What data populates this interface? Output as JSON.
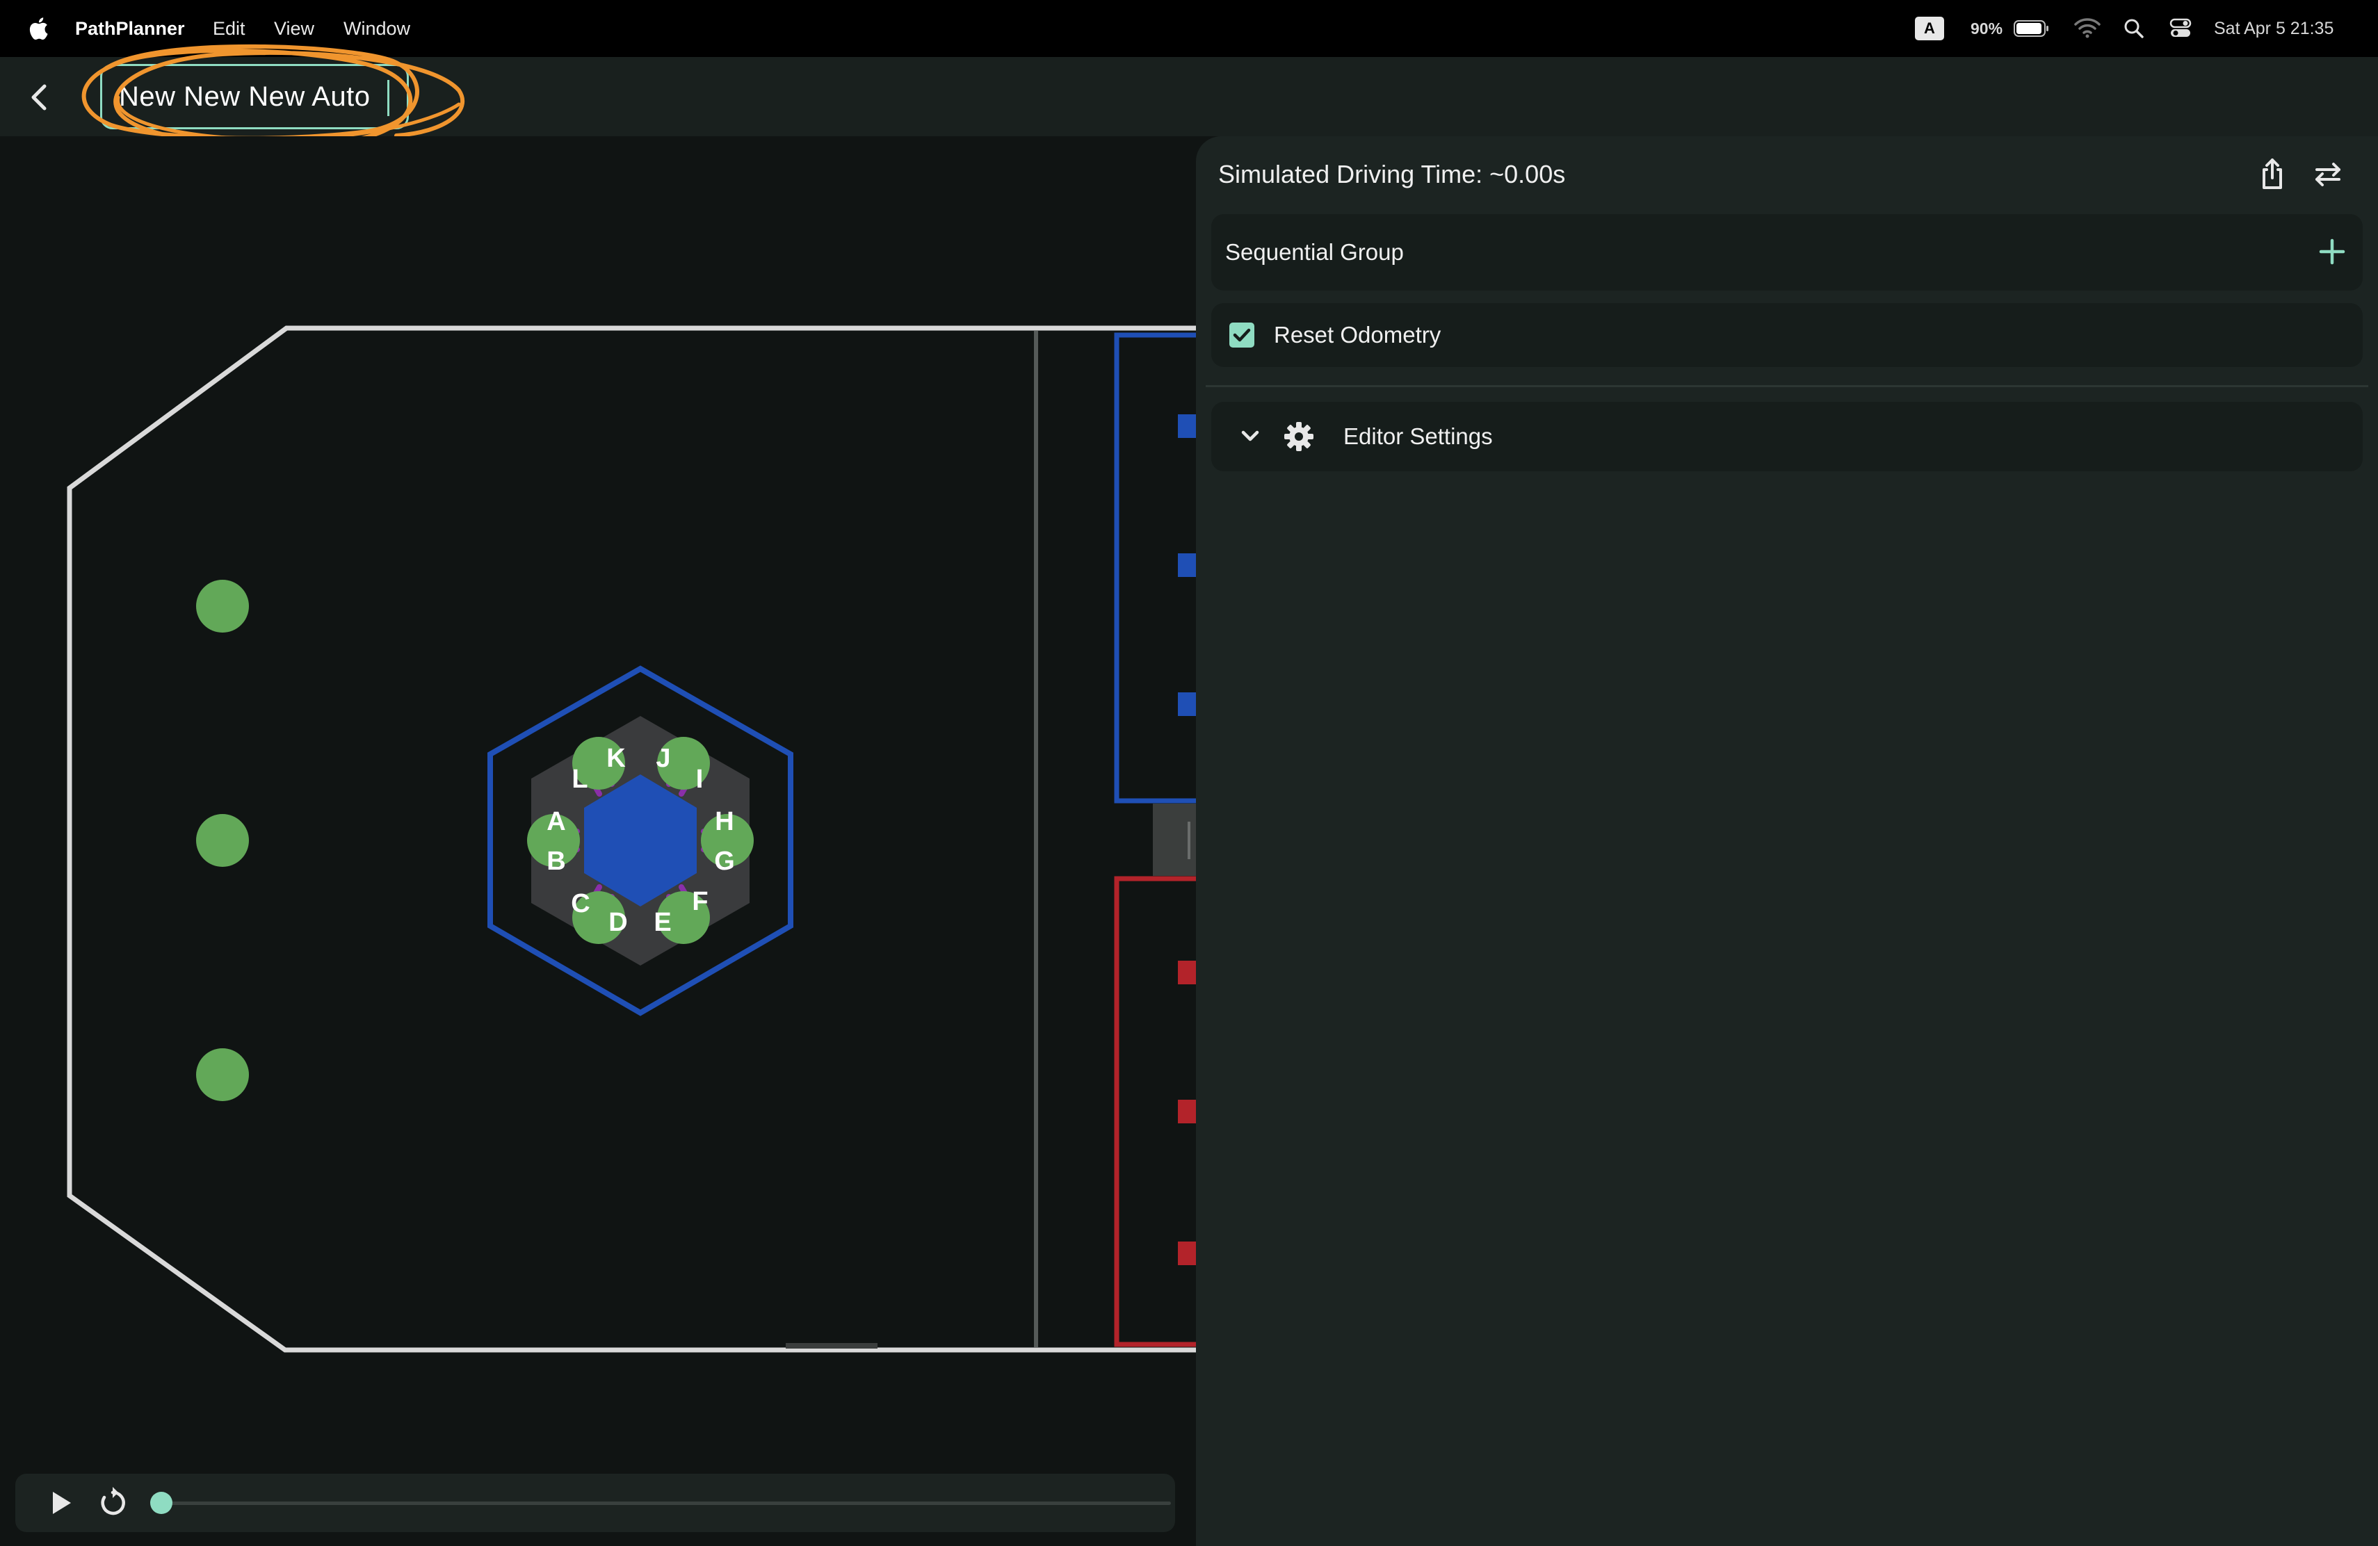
{
  "menubar": {
    "app_name": "PathPlanner",
    "menus": [
      "Edit",
      "View",
      "Window"
    ],
    "input_source": "A",
    "battery": "90%",
    "datetime": "Sat Apr 5  21:35",
    "icons": [
      "apple-icon",
      "battery-icon",
      "wifi-icon",
      "search-icon",
      "control-center-icon"
    ]
  },
  "header": {
    "auto_name": "New New New Auto"
  },
  "field": {
    "reef_labels": [
      "A",
      "B",
      "C",
      "D",
      "E",
      "F",
      "G",
      "H",
      "I",
      "J",
      "K",
      "L"
    ],
    "colors": {
      "border": "#d9d9d9",
      "reef_blue": "#1f4fb5",
      "alliance_red": "#b3232a",
      "algae_green": "#62a858",
      "reef_grey": "#3a3b3d",
      "branch_purple": "#8a2fa8"
    }
  },
  "playback": {
    "progress": 0,
    "icons": [
      "play-icon",
      "restart-icon"
    ]
  },
  "panel": {
    "sim_time": "Simulated Driving Time: ~0.00s",
    "sequential_group": "Sequential Group",
    "reset_odometry": "Reset Odometry",
    "reset_odometry_checked": true,
    "editor_settings": "Editor Settings",
    "accent": "#8fdcc2",
    "icons": [
      "share-icon",
      "swap-icon",
      "add-icon",
      "checkbox-icon",
      "chevron-down-icon",
      "gear-icon"
    ]
  }
}
